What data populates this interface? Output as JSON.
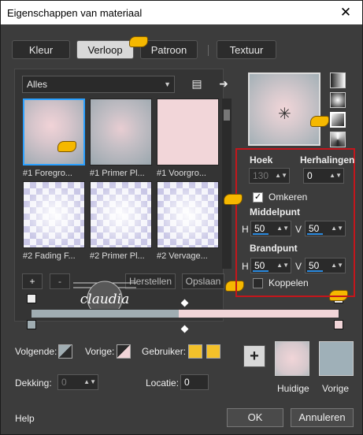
{
  "window": {
    "title": "Eigenschappen van materiaal"
  },
  "tabs": [
    {
      "label": "Kleur",
      "active": false
    },
    {
      "label": "Verloop",
      "active": true
    },
    {
      "label": "Patroon",
      "active": false
    },
    {
      "label": "Textuur",
      "active": false
    }
  ],
  "library": {
    "category": "Alles",
    "thumbnails": [
      {
        "caption": "#1 Foregro..."
      },
      {
        "caption": "#1 Primer Pl..."
      },
      {
        "caption": "#1 Voorgro..."
      },
      {
        "caption": "#2 Fading F..."
      },
      {
        "caption": "#2 Primer Pl..."
      },
      {
        "caption": "#2 Vervage..."
      }
    ]
  },
  "toolbar": {
    "add_label": "+",
    "remove_label": "-",
    "reset_label": "Herstellen",
    "save_label": "Opslaan"
  },
  "gradient_colors": {
    "left": "#a0adb2",
    "right": "#f1d5d8"
  },
  "settings": {
    "hoek_label": "Hoek",
    "hoek_value": "130",
    "herhalingen_label": "Herhalingen",
    "herhalingen_value": "0",
    "omkeren_label": "Omkeren",
    "omkeren_checked": true,
    "middelpunt_label": "Middelpunt",
    "middelpunt_h_label": "H",
    "middelpunt_h": "50",
    "middelpunt_v_label": "V",
    "middelpunt_v": "50",
    "brandpunt_label": "Brandpunt",
    "brandpunt_h_label": "H",
    "brandpunt_h": "50",
    "brandpunt_v_label": "V",
    "brandpunt_v": "50",
    "koppelen_label": "Koppelen",
    "koppelen_checked": false
  },
  "stops": {
    "volgende_label": "Volgende:",
    "vorige_label": "Vorige:",
    "gebruiker_label": "Gebruiker:",
    "gebruiker_color": "#f3c12a",
    "dekking_label": "Dekking:",
    "dekking_value": "0",
    "locatie_label": "Locatie:",
    "locatie_value": "0"
  },
  "swatches": {
    "huidige_label": "Huidige",
    "vorige_label": "Vorige",
    "huidige_color": "#e9cfd3",
    "vorige_color": "#9fb0b8"
  },
  "footer": {
    "help_label": "Help",
    "ok_label": "OK",
    "cancel_label": "Annuleren"
  },
  "watermark": {
    "text": "claudia"
  }
}
